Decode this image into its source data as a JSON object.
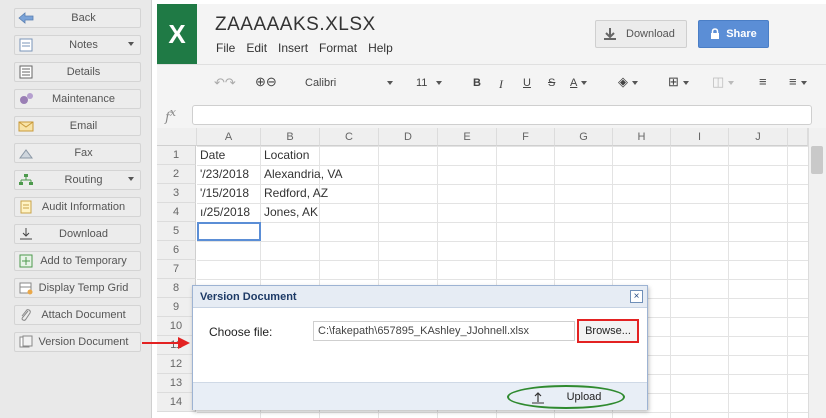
{
  "sidebar": {
    "items": [
      {
        "label": "Back",
        "icon": "back-arrow-icon",
        "dropdown": false
      },
      {
        "label": "Notes",
        "icon": "notes-icon",
        "dropdown": true
      },
      {
        "label": "Details",
        "icon": "details-icon",
        "dropdown": false
      },
      {
        "label": "Maintenance",
        "icon": "gears-icon",
        "dropdown": false
      },
      {
        "label": "Email",
        "icon": "envelope-icon",
        "dropdown": false
      },
      {
        "label": "Fax",
        "icon": "fax-icon",
        "dropdown": false
      },
      {
        "label": "Routing",
        "icon": "routing-icon",
        "dropdown": true
      },
      {
        "label": "Audit Information",
        "icon": "audit-icon",
        "dropdown": false
      },
      {
        "label": "Download",
        "icon": "download-icon",
        "dropdown": false
      },
      {
        "label": "Add to Temporary",
        "icon": "plus-icon",
        "dropdown": false
      },
      {
        "label": "Display Temp Grid",
        "icon": "grid-icon",
        "dropdown": false
      },
      {
        "label": "Attach Document",
        "icon": "paperclip-icon",
        "dropdown": false
      },
      {
        "label": "Version Document",
        "icon": "version-icon",
        "dropdown": false
      }
    ]
  },
  "header": {
    "logo": "X",
    "file_title": "ZAAAAAKS.XLSX",
    "menu": [
      "File",
      "Edit",
      "Insert",
      "Format",
      "Help"
    ],
    "download_label": "Download",
    "share_label": "Share"
  },
  "toolbar": {
    "font_name": "Calibri",
    "font_size": "11",
    "bold": "B",
    "italic": "I",
    "underline": "U",
    "strike": "S",
    "font_color": "A"
  },
  "formula_bar": {
    "label": "f",
    "label_sup": "x",
    "value": ""
  },
  "grid": {
    "columns": [
      "A",
      "B",
      "C",
      "D",
      "E",
      "F",
      "G",
      "H",
      "I",
      "J"
    ],
    "rows": [
      "1",
      "2",
      "3",
      "4",
      "5",
      "6",
      "7",
      "8",
      "9",
      "10",
      "11",
      "12",
      "13",
      "14"
    ],
    "cells": [
      [
        "Date",
        "Location"
      ],
      [
        "'/23/2018",
        "Alexandria, VA"
      ],
      [
        "'/15/2018",
        "Redford, AZ"
      ],
      [
        "ı/25/2018",
        "Jones, AK"
      ]
    ],
    "selected_cell": "A5"
  },
  "dialog": {
    "title": "Version Document",
    "close": "×",
    "choose_label": "Choose file:",
    "file_path": "C:\\fakepath\\657895_KAshley_JJohnell.xlsx",
    "browse_label": "Browse...",
    "upload_label": "Upload"
  },
  "colors": {
    "brand_green": "#1f7a45",
    "share_blue": "#5b8ed6",
    "highlight_red": "#e32222",
    "highlight_green": "#2f8a2f"
  }
}
